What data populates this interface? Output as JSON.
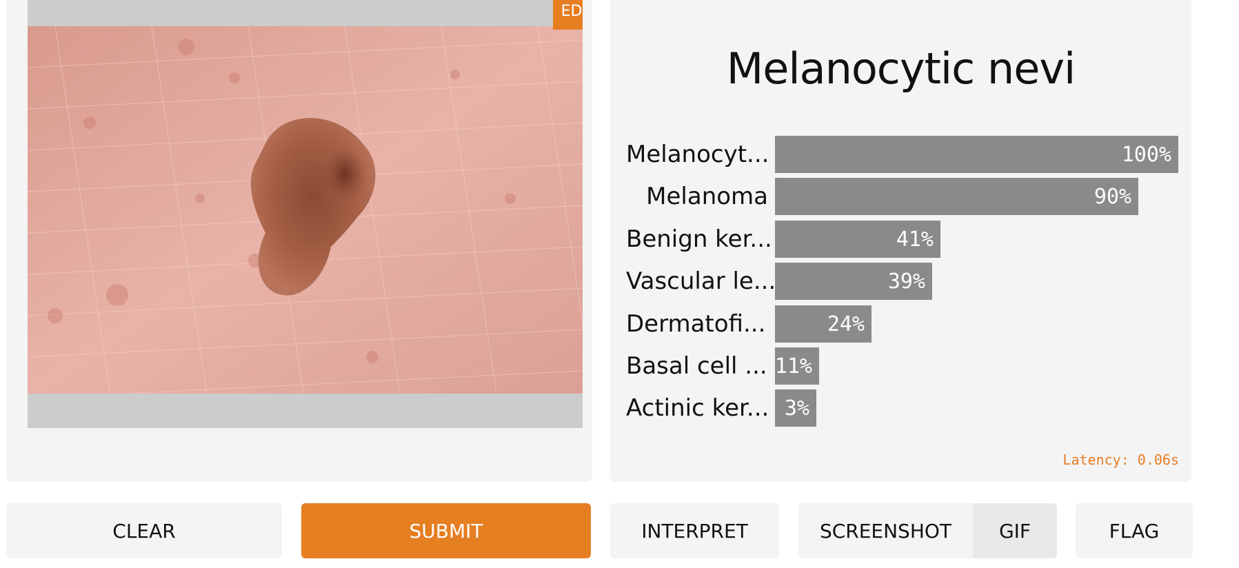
{
  "input": {
    "edit_label": "EDIT"
  },
  "output": {
    "title": "Melanocytic nevi",
    "predictions": [
      {
        "label": "Melanocyt...",
        "percent_text": "100%",
        "value": 1.0
      },
      {
        "label": "Melanoma",
        "percent_text": "90%",
        "value": 0.9
      },
      {
        "label": "Benign ker...",
        "percent_text": "41%",
        "value": 0.41
      },
      {
        "label": "Vascular le...",
        "percent_text": "39%",
        "value": 0.39
      },
      {
        "label": "Dermatofi...",
        "percent_text": "24%",
        "value": 0.24
      },
      {
        "label": "Basal cell ...",
        "percent_text": "11%",
        "value": 0.11
      },
      {
        "label": "Actinic ker...",
        "percent_text": "3%",
        "value": 0.03
      }
    ],
    "latency": "Latency: 0.06s"
  },
  "buttons": {
    "clear": "CLEAR",
    "submit": "SUBMIT",
    "interpret": "INTERPRET",
    "screenshot": "SCREENSHOT",
    "gif": "GIF",
    "flag": "FLAG"
  },
  "colors": {
    "accent": "#e67e22",
    "bar": "#8a8a8a",
    "panel": "#f4f4f4"
  }
}
